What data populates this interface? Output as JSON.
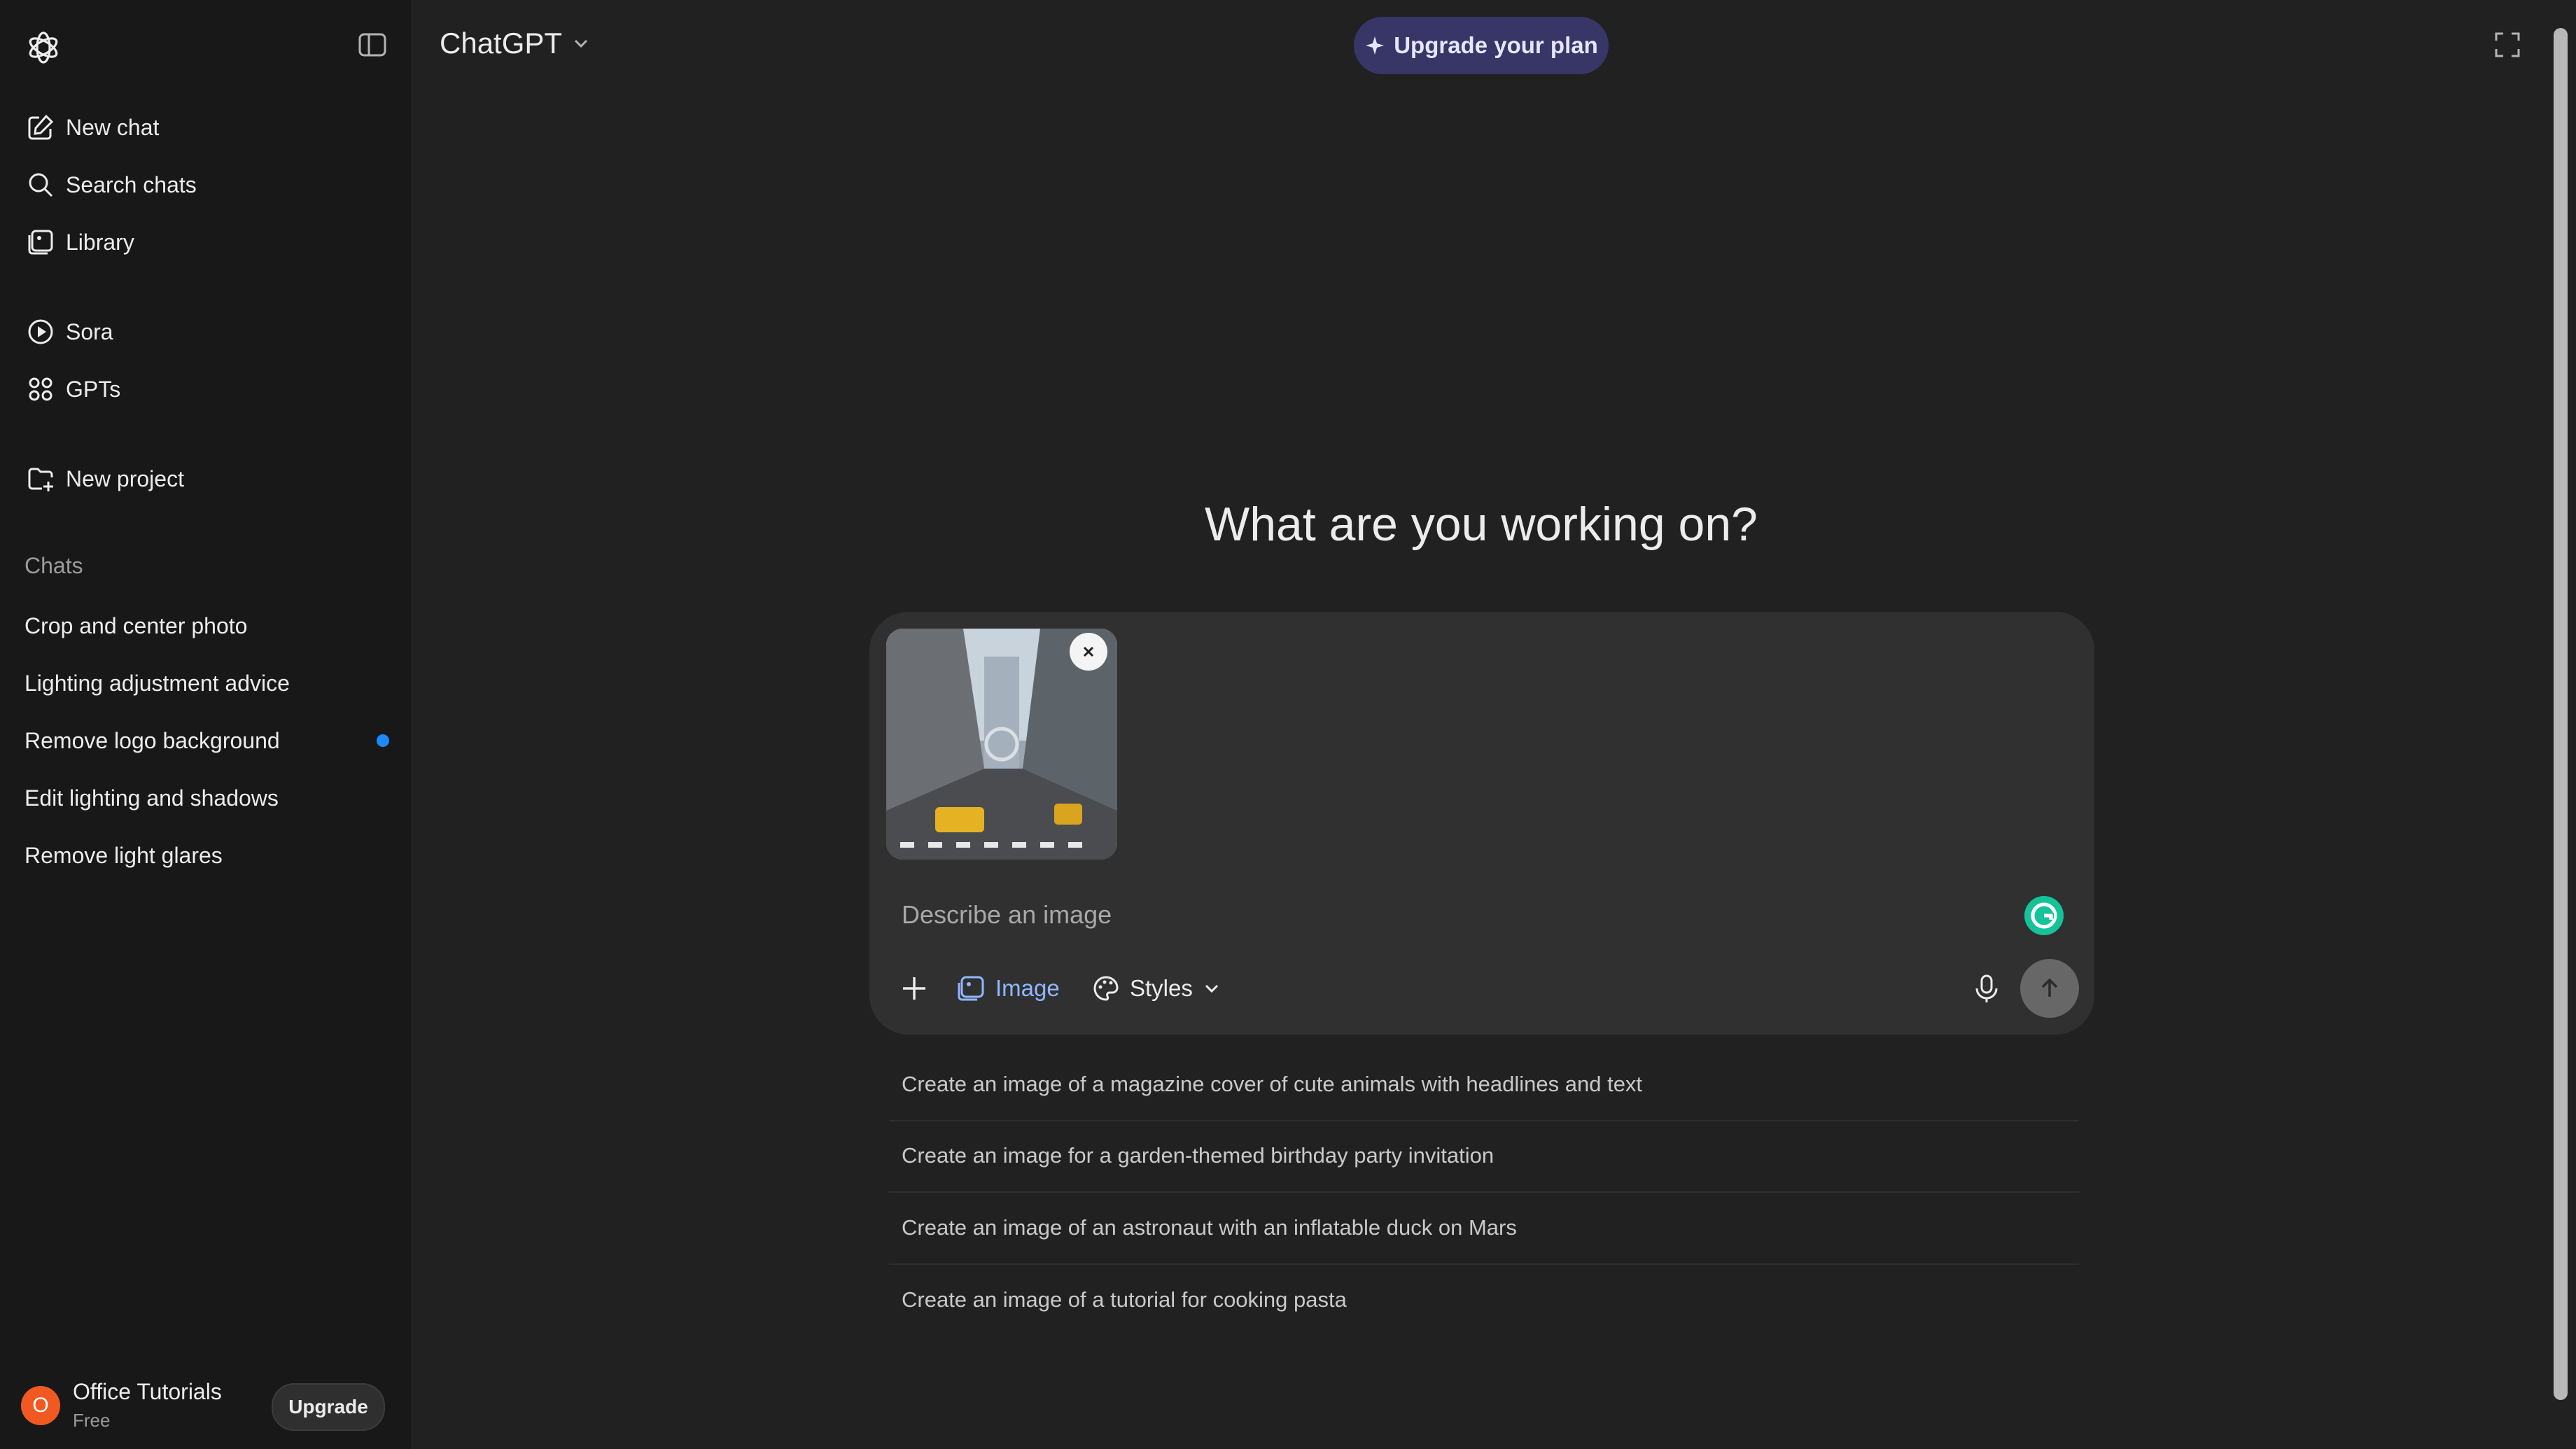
{
  "app": {
    "title": "ChatGPT",
    "upgrade_plan_label": "Upgrade your plan",
    "accent_color": "#373667"
  },
  "sidebar": {
    "nav": [
      {
        "label": "New chat",
        "icon": "edit-icon"
      },
      {
        "label": "Search chats",
        "icon": "search-icon"
      },
      {
        "label": "Library",
        "icon": "library-icon"
      },
      {
        "label": "Sora",
        "icon": "play-circle-icon"
      },
      {
        "label": "GPTs",
        "icon": "grid-icon"
      },
      {
        "label": "New project",
        "icon": "folder-plus-icon"
      }
    ],
    "chats_title": "Chats",
    "chats": [
      {
        "label": "Crop and center photo"
      },
      {
        "label": "Lighting adjustment advice"
      },
      {
        "label": "Remove logo background",
        "unread": true
      },
      {
        "label": "Edit lighting and shadows"
      },
      {
        "label": "Remove light glares"
      }
    ],
    "profile": {
      "initial": "O",
      "name": "Office Tutorials",
      "plan": "Free",
      "upgrade_label": "Upgrade",
      "avatar_color": "#f05a22"
    }
  },
  "main": {
    "hero": "What are you working on?",
    "composer": {
      "placeholder": "Describe an image",
      "tools": {
        "image_label": "Image",
        "styles_label": "Styles"
      },
      "attachment": "city-street-photo",
      "image_color": "#8fb8ff"
    },
    "suggestions": [
      "Create an image of a magazine cover of cute animals with headlines and text",
      "Create an image for a garden-themed birthday party invitation",
      "Create an image of an astronaut with an inflatable duck on Mars",
      "Create an image of a tutorial for cooking pasta"
    ]
  }
}
